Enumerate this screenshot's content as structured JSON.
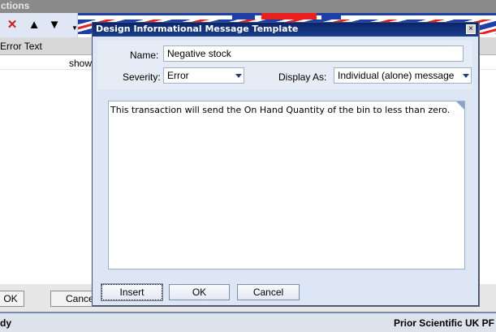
{
  "background_window": {
    "title": "ctions",
    "toolbar": {
      "delete_icon": "x-icon",
      "up_icon": "arrow-up-icon",
      "down_icon": "arrow-down-icon"
    },
    "grid": {
      "column_header": "Error Text",
      "row_value": "show"
    },
    "ok_label": "OK",
    "cancel_label": "Cance",
    "status_left": "dy",
    "status_right": "Prior Scientific UK  PF"
  },
  "dialog": {
    "title": "Design Informational Message Template",
    "name_label": "Name:",
    "name_value": "Negative stock",
    "severity_label": "Severity:",
    "severity_value": "Error",
    "display_as_label": "Display As:",
    "display_as_value": "Individual (alone) message",
    "message_text": "This transaction will send the On Hand Quantity of the bin to less than zero.",
    "insert_label": "Insert",
    "ok_label": "OK",
    "cancel_label": "Cancel"
  },
  "colors": {
    "accent": "#0a246a",
    "flag_red": "#e82020",
    "flag_blue": "#1f3fa8"
  }
}
